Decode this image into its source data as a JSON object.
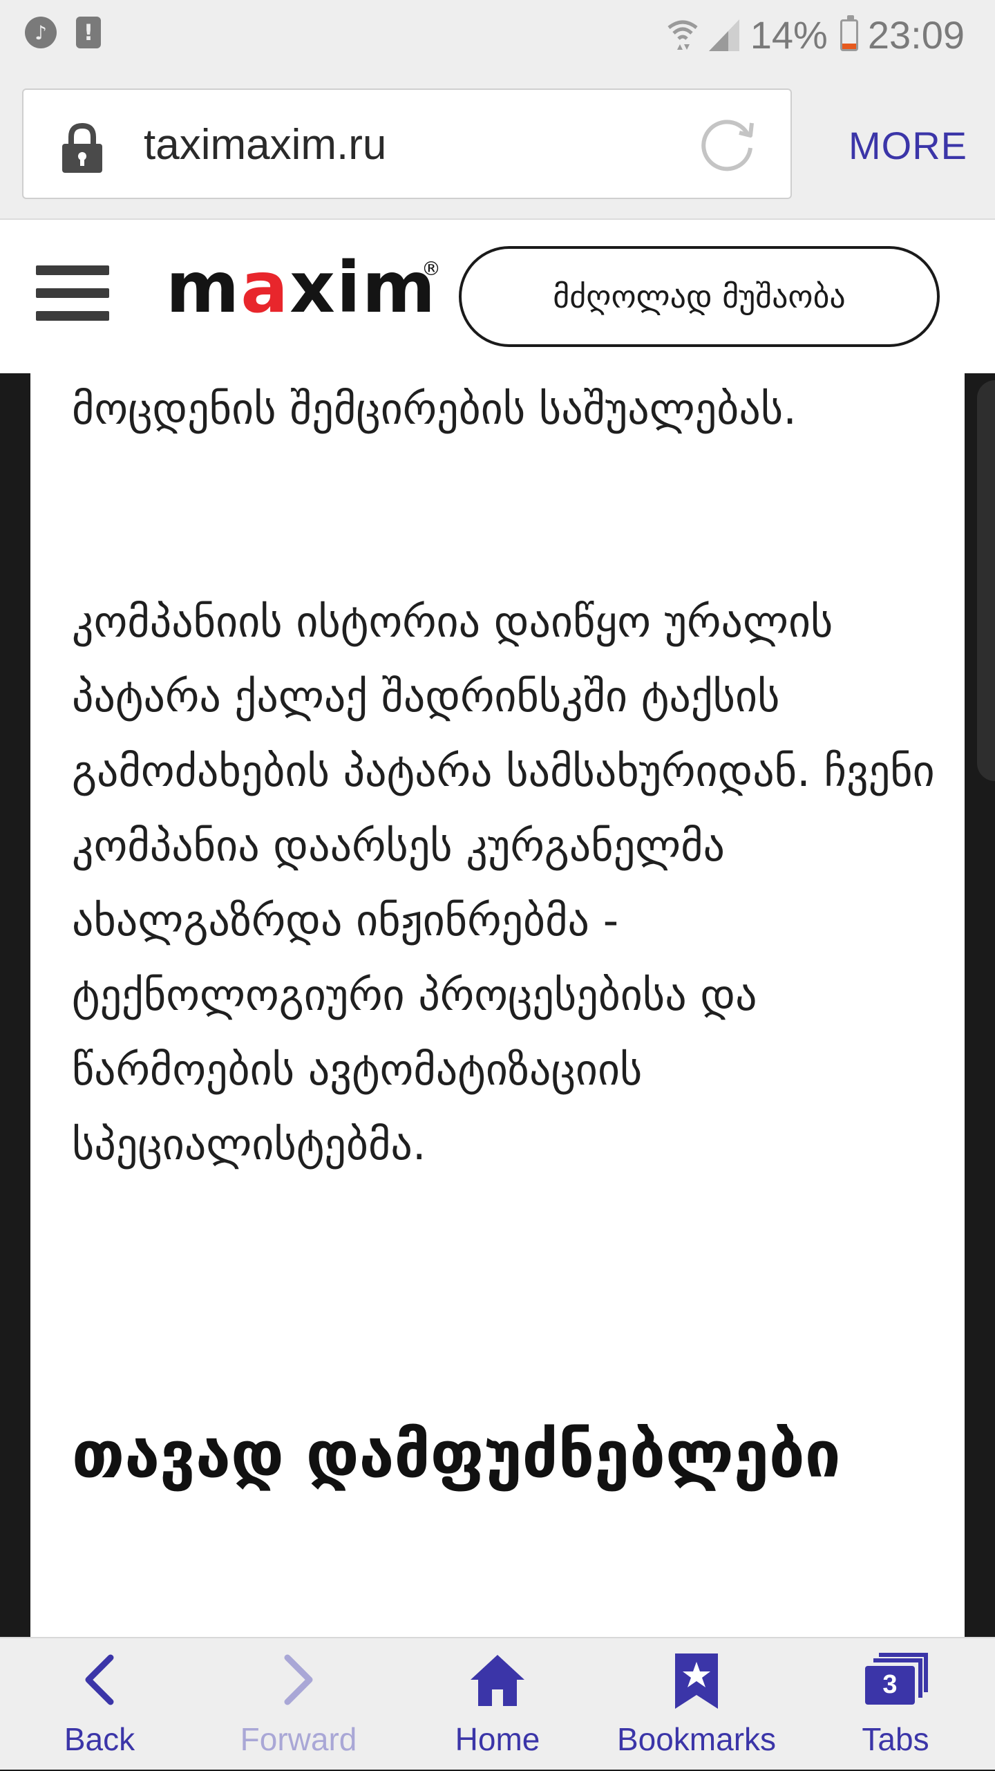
{
  "status_bar": {
    "battery": "14%",
    "time": "23:09",
    "icons": [
      "music-notification-icon",
      "alert-notification-icon",
      "wifi-icon",
      "signal-icon",
      "battery-icon"
    ]
  },
  "browser": {
    "url": "taximaxim.ru",
    "more_label": "MORE"
  },
  "site_header": {
    "logo": {
      "part1": "m",
      "part2": "a",
      "part3": "xim",
      "reg": "®"
    },
    "driver_button": "მძღოლად მუშაობა"
  },
  "content": {
    "paragraph_1": "მოცდენის შემცირების საშუალებას.",
    "paragraph_2": "კომპანიის ისტორია დაიწყო ურალის პატარა ქალაქ შადრინსკში ტაქსის გამოძახების პატარა სამსახურიდან. ჩვენი კომპანია დაარსეს კურგანელმა ახალგაზრდა ინჟინრებმა - ტექნოლოგიური პროცესებისა და წარმოების ავტომატიზაციის სპეციალისტებმა.",
    "heading": "თავად დამფუძნებლები"
  },
  "bottom_nav": {
    "back": "Back",
    "forward": "Forward",
    "home": "Home",
    "bookmarks": "Bookmarks",
    "tabs": "Tabs",
    "tabs_count": "3"
  },
  "colors": {
    "accent": "#3b35a8",
    "accent_disabled": "#a9a7d6",
    "logo_red": "#e8262c"
  }
}
